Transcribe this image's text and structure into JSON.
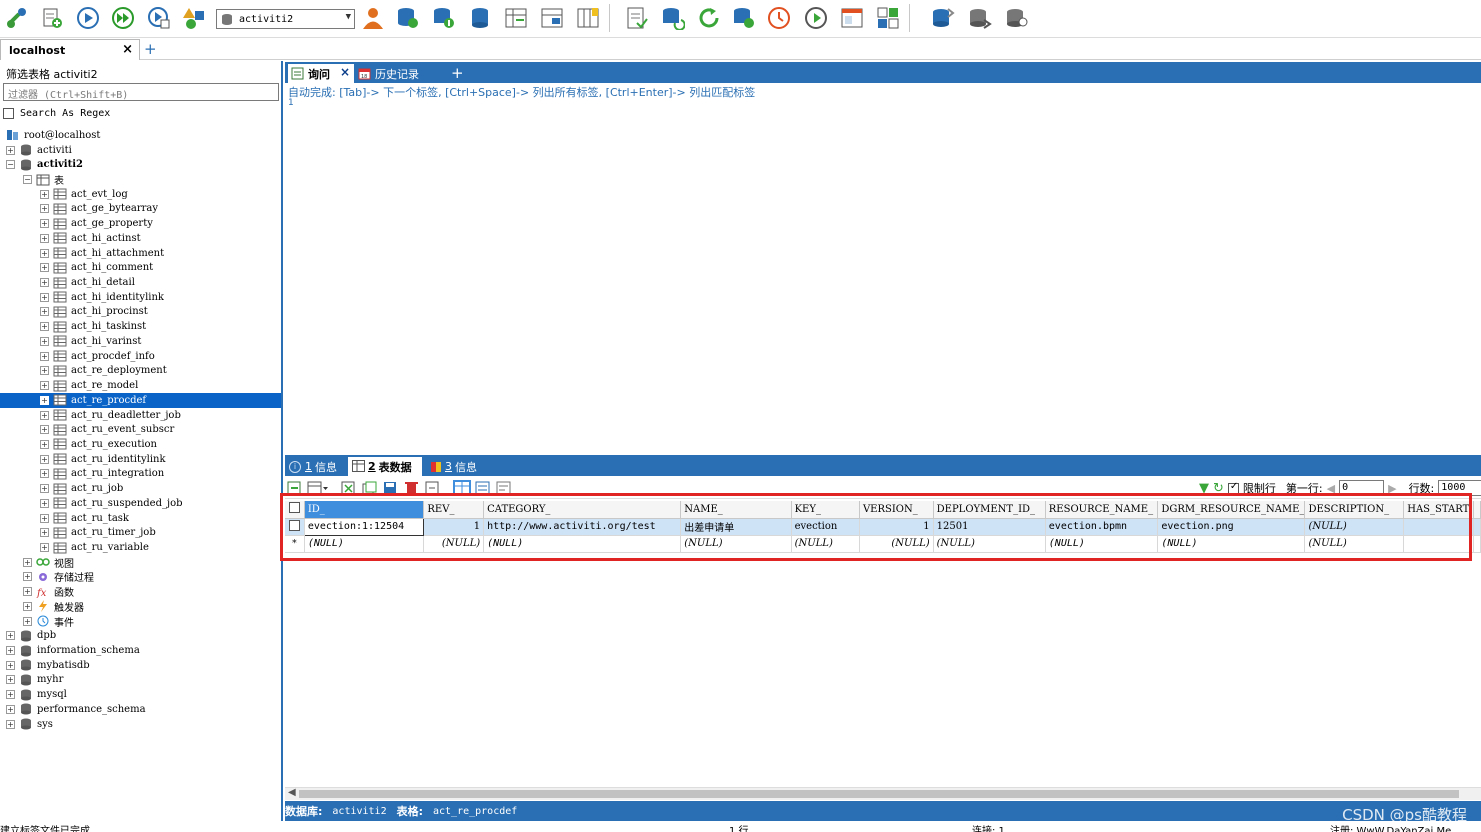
{
  "toolbar": {
    "database_select": "activiti2",
    "icons": [
      "connection-icon",
      "new-query-icon",
      "execute-icon",
      "execute-all-icon",
      "execute-step-icon",
      "schema-designer-icon",
      "database-select-icon",
      "user-manager-icon",
      "backup-icon",
      "import-icon",
      "export-icon",
      "data-sync-icon",
      "structure-sync-icon",
      "visual-compare-icon",
      "query-builder-icon",
      "format-icon",
      "refresh-icon",
      "restore-icon",
      "history-icon",
      "scheduler-icon",
      "window-icon",
      "layout-icon",
      "database-copy-icon",
      "database-transfer-icon",
      "database-compare-icon"
    ]
  },
  "connection_tab": {
    "label": "localhost",
    "close": "×",
    "add": "+"
  },
  "left_panel": {
    "filter_label": "筛选表格 activiti2",
    "filter_placeholder": "过滤器 (Ctrl+Shift+B)",
    "regex_label": "Search As Regex",
    "tree": [
      {
        "label": "root@localhost",
        "level": 0,
        "expander": "",
        "icon": "server"
      },
      {
        "label": "activiti",
        "level": 0,
        "expander": "+",
        "icon": "db"
      },
      {
        "label": "activiti2",
        "level": 0,
        "expander": "−",
        "icon": "db",
        "bold": true
      },
      {
        "label": "表",
        "level": 1,
        "expander": "−",
        "icon": "tablefolder"
      },
      {
        "label": "act_evt_log",
        "level": 2,
        "expander": "+",
        "icon": "table"
      },
      {
        "label": "act_ge_bytearray",
        "level": 2,
        "expander": "+",
        "icon": "table"
      },
      {
        "label": "act_ge_property",
        "level": 2,
        "expander": "+",
        "icon": "table"
      },
      {
        "label": "act_hi_actinst",
        "level": 2,
        "expander": "+",
        "icon": "table"
      },
      {
        "label": "act_hi_attachment",
        "level": 2,
        "expander": "+",
        "icon": "table"
      },
      {
        "label": "act_hi_comment",
        "level": 2,
        "expander": "+",
        "icon": "table"
      },
      {
        "label": "act_hi_detail",
        "level": 2,
        "expander": "+",
        "icon": "table"
      },
      {
        "label": "act_hi_identitylink",
        "level": 2,
        "expander": "+",
        "icon": "table"
      },
      {
        "label": "act_hi_procinst",
        "level": 2,
        "expander": "+",
        "icon": "table"
      },
      {
        "label": "act_hi_taskinst",
        "level": 2,
        "expander": "+",
        "icon": "table"
      },
      {
        "label": "act_hi_varinst",
        "level": 2,
        "expander": "+",
        "icon": "table"
      },
      {
        "label": "act_procdef_info",
        "level": 2,
        "expander": "+",
        "icon": "table"
      },
      {
        "label": "act_re_deployment",
        "level": 2,
        "expander": "+",
        "icon": "table"
      },
      {
        "label": "act_re_model",
        "level": 2,
        "expander": "+",
        "icon": "table"
      },
      {
        "label": "act_re_procdef",
        "level": 2,
        "expander": "+",
        "icon": "table",
        "selected": true
      },
      {
        "label": "act_ru_deadletter_job",
        "level": 2,
        "expander": "+",
        "icon": "table"
      },
      {
        "label": "act_ru_event_subscr",
        "level": 2,
        "expander": "+",
        "icon": "table"
      },
      {
        "label": "act_ru_execution",
        "level": 2,
        "expander": "+",
        "icon": "table"
      },
      {
        "label": "act_ru_identitylink",
        "level": 2,
        "expander": "+",
        "icon": "table"
      },
      {
        "label": "act_ru_integration",
        "level": 2,
        "expander": "+",
        "icon": "table"
      },
      {
        "label": "act_ru_job",
        "level": 2,
        "expander": "+",
        "icon": "table"
      },
      {
        "label": "act_ru_suspended_job",
        "level": 2,
        "expander": "+",
        "icon": "table"
      },
      {
        "label": "act_ru_task",
        "level": 2,
        "expander": "+",
        "icon": "table"
      },
      {
        "label": "act_ru_timer_job",
        "level": 2,
        "expander": "+",
        "icon": "table"
      },
      {
        "label": "act_ru_variable",
        "level": 2,
        "expander": "+",
        "icon": "table"
      },
      {
        "label": "视图",
        "level": 1,
        "expander": "+",
        "icon": "view"
      },
      {
        "label": "存储过程",
        "level": 1,
        "expander": "+",
        "icon": "proc"
      },
      {
        "label": "函数",
        "level": 1,
        "expander": "+",
        "icon": "func"
      },
      {
        "label": "触发器",
        "level": 1,
        "expander": "+",
        "icon": "trigger"
      },
      {
        "label": "事件",
        "level": 1,
        "expander": "+",
        "icon": "event"
      },
      {
        "label": "dpb",
        "level": 0,
        "expander": "+",
        "icon": "db"
      },
      {
        "label": "information_schema",
        "level": 0,
        "expander": "+",
        "icon": "db"
      },
      {
        "label": "mybatisdb",
        "level": 0,
        "expander": "+",
        "icon": "db"
      },
      {
        "label": "myhr",
        "level": 0,
        "expander": "+",
        "icon": "db"
      },
      {
        "label": "mysql",
        "level": 0,
        "expander": "+",
        "icon": "db"
      },
      {
        "label": "performance_schema",
        "level": 0,
        "expander": "+",
        "icon": "db"
      },
      {
        "label": "sys",
        "level": 0,
        "expander": "+",
        "icon": "db"
      }
    ]
  },
  "query_tabs": {
    "query": "询问",
    "history": "历史记录",
    "add": "+",
    "close": "×"
  },
  "editor": {
    "hint": "自动完成: [Tab]-> 下一个标签, [Ctrl+Space]-> 列出所有标签, [Ctrl+Enter]-> 列出匹配标签",
    "line_number": "1"
  },
  "result_tabs": {
    "info1_num": "1",
    "info1_label": "信息",
    "data_num": "2",
    "data_label": "表数据",
    "info3_num": "3",
    "info3_label": "信息"
  },
  "result_toolbar": {
    "limit_label": "限制行",
    "first_row_label": "第一行:",
    "first_row_value": "0",
    "rows_label": "行数:",
    "rows_value": "1000"
  },
  "grid": {
    "columns": [
      "ID_",
      "REV_",
      "CATEGORY_",
      "NAME_",
      "KEY_",
      "VERSION_",
      "DEPLOYMENT_ID_",
      "RESOURCE_NAME_",
      "DGRM_RESOURCE_NAME_",
      "DESCRIPTION_",
      "HAS_START"
    ],
    "rows": [
      [
        "evection:1:12504",
        "1",
        "http://www.activiti.org/test",
        "出差申请单",
        "evection",
        "1",
        "12501",
        "evection.bpmn",
        "evection.png",
        "(NULL)",
        ""
      ],
      [
        "(NULL)",
        "(NULL)",
        "(NULL)",
        "(NULL)",
        "(NULL)",
        "(NULL)",
        "(NULL)",
        "(NULL)",
        "(NULL)",
        "(NULL)",
        ""
      ]
    ],
    "new_row_marker": "*"
  },
  "info_bar": {
    "db_label": "数据库:",
    "db_value": "activiti2",
    "table_label": "表格:",
    "table_value": "act_re_procdef"
  },
  "watermark": "CSDN @ps酷教程",
  "status": {
    "left": "建立标签文件已完成",
    "rows": "1 行",
    "conn": "连接: 1",
    "reg": "注册: WwW.DaYanZai.Me"
  }
}
